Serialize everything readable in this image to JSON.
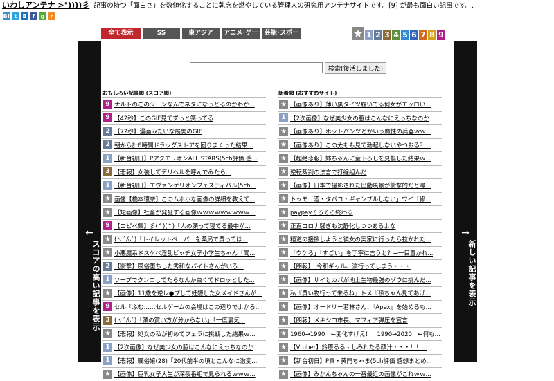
{
  "site": {
    "name": "いわしアンテナ >°))))彡",
    "description": "記事の持つ「面白さ」を数値化することに執念を燃やしている管理人の研究用アンテナサイトです。[9] が最も面白い記事です。."
  },
  "social_icons": [
    {
      "name": "hatena",
      "glyph": "B!",
      "color": "#3b8ccc"
    },
    {
      "name": "twitter",
      "glyph": "t",
      "color": "#29a8e0"
    },
    {
      "name": "hatena-b",
      "glyph": "B",
      "color": "#1f6fb8"
    },
    {
      "name": "facebook",
      "glyph": "f",
      "color": "#3b5998"
    },
    {
      "name": "google",
      "glyph": "g",
      "color": "#55aa33"
    },
    {
      "name": "rss",
      "glyph": "r",
      "color": "#f08a24"
    }
  ],
  "tabs": [
    {
      "label": "全て表示",
      "active": true,
      "width": 57
    },
    {
      "label": "SS",
      "active": false,
      "width": 54
    },
    {
      "label": "東アジア",
      "active": false,
      "width": 54
    },
    {
      "label": "アニメ･ゲーム",
      "active": false,
      "width": 56
    },
    {
      "label": "芸能･スポーツ",
      "active": false,
      "width": 55
    }
  ],
  "rank_selector": {
    "star": "★",
    "numbers": [
      {
        "n": "1",
        "color": "#8aa1c3"
      },
      {
        "n": "2",
        "color": "#667b99"
      },
      {
        "n": "3",
        "color": "#8a6a3a"
      },
      {
        "n": "4",
        "color": "#5f8f3a"
      },
      {
        "n": "5",
        "color": "#2f8ad0"
      },
      {
        "n": "6",
        "color": "#3366bb"
      },
      {
        "n": "7",
        "color": "#d06a1a"
      },
      {
        "n": "8",
        "color": "#d8a01a"
      },
      {
        "n": "9",
        "color": "#b0208a"
      }
    ]
  },
  "search": {
    "value": "",
    "button_label": "検索(復活しました)"
  },
  "left_sidebar": {
    "arrow": "←",
    "label": "スコアの高い記事を表示"
  },
  "right_sidebar": {
    "arrow": "→",
    "label": "新しい記事を表示"
  },
  "colors": {
    "9": "#b0208a",
    "4": "#6c7a90",
    "3": "#8a6a3a",
    "2": "#667b99",
    "1": "#8aa1c3",
    "star": "#888888"
  },
  "left_column": {
    "heading": "おもしろい記事順 (スコア順)",
    "items": [
      {
        "rank": "9",
        "title": "ナルトのこのシーンなんでネタになっとるのかわか..."
      },
      {
        "rank": "9",
        "title": "【42秒】このGIF見てずっと笑ってる"
      },
      {
        "rank": "2",
        "title": "【72秒】漫画みたいな展開のGIF"
      },
      {
        "rank": "2",
        "title": "朝から計6時間ドラッグストアを回りまくった結果..."
      },
      {
        "rank": "1",
        "title": "【新台初日】PアクエリオンALL STARS(5ch評価 感..."
      },
      {
        "rank": "3",
        "title": "【悲報】女装してデリヘルを呼んでみたら…"
      },
      {
        "rank": "1",
        "title": "【新台初日】エヴァンゲリオンフェスティバル(5ch..."
      },
      {
        "rank": "★",
        "title": "画像【橋本環奈】このムホホな画像の詳細を教えて..."
      },
      {
        "rank": "★",
        "title": "【短画像】社畜が発狂する画像ｗｗｗｗｗｗｗｗｗ..."
      },
      {
        "rank": "9",
        "title": "【コピペ集】彡(^)(^)「人の顔って寝てる最中が..."
      },
      {
        "rank": "★",
        "title": "(ヽ´ん`)「トイレットペーパーを薬局で買ってほ..."
      },
      {
        "rank": "★",
        "title": "小悪魔系ドスケベ淫乱ビッチ女子小学生ちゃん「聞..."
      },
      {
        "rank": "2",
        "title": "【衝撃】風俗堕ちした秀和なバイトさんがいろ..."
      },
      {
        "rank": "1",
        "title": "ソープでクンニしてたらなんか白くてドロッとした..."
      },
      {
        "rank": "★",
        "title": "【画像】11歳を逆レ●プして妊娠した女メイドさんが..."
      },
      {
        "rank": "9",
        "title": "セル「ふむ……セルゲームの会場はこの辺りでよかろ..."
      },
      {
        "rank": "3",
        "title": "(ヽ´ん`)「顔の賞い方が分からない」「一度裏気..."
      },
      {
        "rank": "★",
        "title": "【悲報】処女の私が初めてフェラに挑戦した結果ｗ..."
      },
      {
        "rank": "1",
        "title": "【2次画像】なぜ美少女の脇はこんなにえっちなのか"
      },
      {
        "rank": "1",
        "title": "【悲報】風俗嬢(28)「20代前半の頃とこんなに激変..."
      },
      {
        "rank": "★",
        "title": "【画像】巨乳女子大生が深夜番組で見られるｗｗｗ..."
      }
    ]
  },
  "right_column": {
    "heading": "新着順 (おすすめサイト)",
    "items": [
      {
        "rank": "★",
        "title": "【画像あり】薄い黒タイツ履いてる何女がエッロい..."
      },
      {
        "rank": "1",
        "title": "【2次画像】なぜ美少女の脇はこんなにえっちなのか"
      },
      {
        "rank": "★",
        "title": "【画像あり】ホットパンツとかいう魔性の兵器ｗｗ..."
      },
      {
        "rank": "★",
        "title": "【画像あり】この太もも見て勃起しないやつおる？..."
      },
      {
        "rank": "★",
        "title": "【超絶悲報】姉ちゃんに童下ろしを見擬した結果ｗ..."
      },
      {
        "rank": "★",
        "title": "逆転裁判の法言で打線組んだ"
      },
      {
        "rank": "★",
        "title": "【画像】日本で撮影された出動風景が衝撃的だと尋..."
      },
      {
        "rank": "★",
        "title": "トッモ「酒・タバコ・ギャンブルしない」ワイ「修..."
      },
      {
        "rank": "★",
        "title": "paypayそろそろ終わる"
      },
      {
        "rank": "★",
        "title": "正直コロナ騒ぎも沈静化しつつあるよな"
      },
      {
        "rank": "★",
        "title": "精道の接拶しようと彼女の実家に行ったら拉かれた..."
      },
      {
        "rank": "★",
        "title": "「ウケる」「すごい」を丁寧に言うと？→一目置かれ..."
      },
      {
        "rank": "★",
        "title": "【朗報】　令和ギャル、流行ってしまう・・・"
      },
      {
        "rank": "★",
        "title": "【画像】サイとカバが地上生物最強のゾウに挑んだ..."
      },
      {
        "rank": "★",
        "title": "私『買い物行って来るね』トメ『孫ちゃん見てあげ..."
      },
      {
        "rank": "★",
        "title": "【画像】オードリー若林さん、『Apex』を始めるも..."
      },
      {
        "rank": "★",
        "title": "【朗報】メキシコ市長、マフィア弾圧を宣言"
      },
      {
        "rank": "★",
        "title": "1960→1990　←変化すげえ！　1990→2020　←何も変わ..."
      },
      {
        "rank": "★",
        "title": "【Vtuber】鈴原るる - しみわたる顔汁・・・！！..."
      },
      {
        "rank": "★",
        "title": "【新台初日】P真・黄門ちゃま(5ch評価 感想まとめ..."
      },
      {
        "rank": "★",
        "title": "【画像】みかんちゃんの一番最近の画像がこれｗｗ..."
      }
    ]
  }
}
